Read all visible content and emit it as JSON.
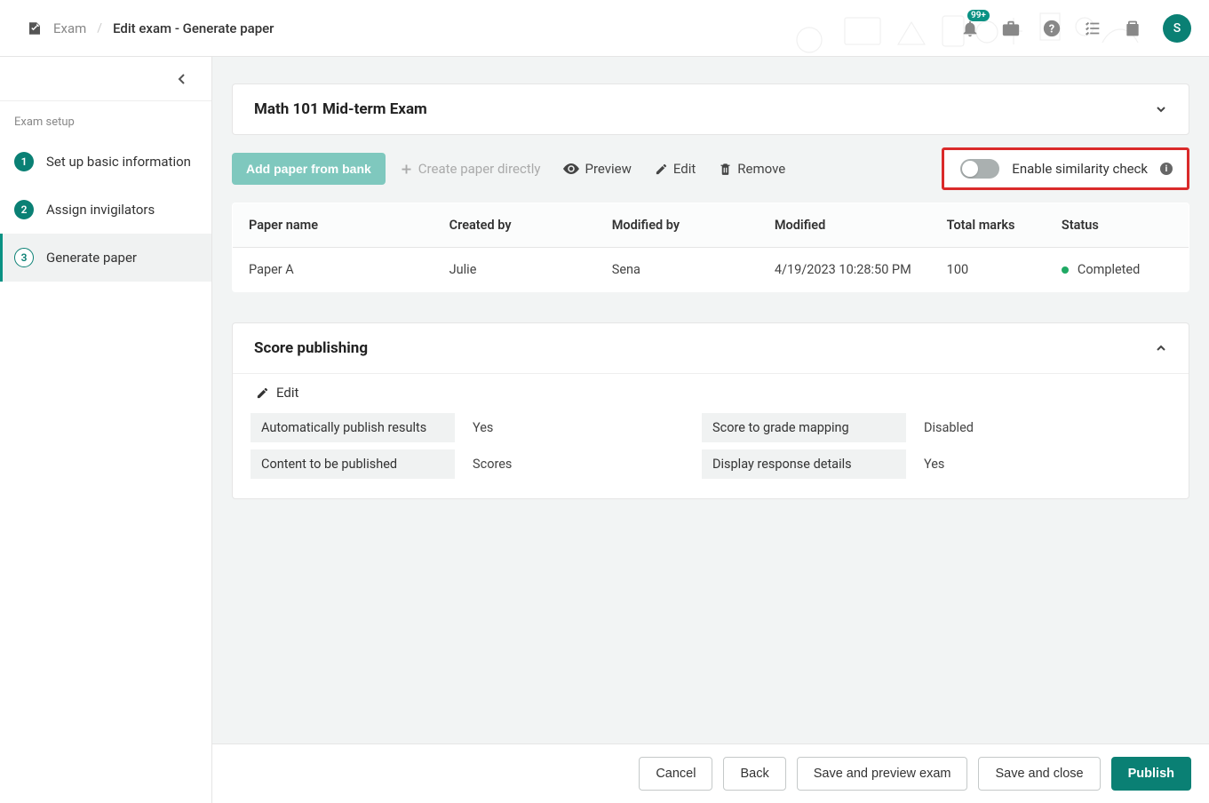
{
  "breadcrumb": {
    "root": "Exam",
    "current": "Edit exam - Generate paper"
  },
  "topbar": {
    "notification_badge": "99+",
    "avatar_initial": "S"
  },
  "sidebar": {
    "title": "Exam setup",
    "steps": [
      {
        "num": "1",
        "label": "Set up basic information"
      },
      {
        "num": "2",
        "label": "Assign invigilators"
      },
      {
        "num": "3",
        "label": "Generate paper"
      }
    ]
  },
  "exam": {
    "title": "Math 101 Mid-term Exam"
  },
  "toolbar": {
    "add_from_bank": "Add paper from bank",
    "create_directly": "Create paper directly",
    "preview": "Preview",
    "edit": "Edit",
    "remove": "Remove",
    "similarity_label": "Enable similarity check"
  },
  "table": {
    "headers": {
      "paper_name": "Paper name",
      "created_by": "Created by",
      "modified_by": "Modified by",
      "modified": "Modified",
      "total_marks": "Total marks",
      "status": "Status"
    },
    "rows": [
      {
        "paper_name": "Paper A",
        "created_by": "Julie",
        "modified_by": "Sena",
        "modified": "4/19/2023 10:28:50 PM",
        "total_marks": "100",
        "status": "Completed"
      }
    ]
  },
  "score_panel": {
    "title": "Score publishing",
    "edit": "Edit",
    "rows": {
      "auto_publish_label": "Automatically publish results",
      "auto_publish_val": "Yes",
      "grade_map_label": "Score to grade mapping",
      "grade_map_val": "Disabled",
      "content_label": "Content to be published",
      "content_val": "Scores",
      "resp_label": "Display response details",
      "resp_val": "Yes"
    }
  },
  "footer": {
    "cancel": "Cancel",
    "back": "Back",
    "save_preview": "Save and preview exam",
    "save_close": "Save and close",
    "publish": "Publish"
  }
}
